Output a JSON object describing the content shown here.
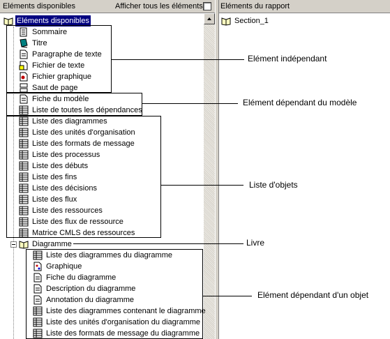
{
  "left_header": {
    "title": "Eléments disponibles",
    "show_all_label": "Afficher tous les éléments"
  },
  "right_header": {
    "title": "Eléments du rapport"
  },
  "report_tree": {
    "section": "Section_1"
  },
  "tree": {
    "root": "Eléments disponibles",
    "independent": [
      "Sommaire",
      "Titre",
      "Paragraphe de texte",
      "Fichier de texte",
      "Fichier graphique",
      "Saut de page"
    ],
    "model_dependent": [
      "Fiche du modèle",
      "Liste de toutes les dépendances"
    ],
    "object_lists": [
      "Liste des diagrammes",
      "Liste des unités d'organisation",
      "Liste des formats de message",
      "Liste des processus",
      "Liste des débuts",
      "Liste des fins",
      "Liste des décisions",
      "Liste des flux",
      "Liste des ressources",
      "Liste des flux de ressource",
      "Matrice CMLS des ressources"
    ],
    "book": "Diagramme",
    "object_dependent": [
      "Liste des diagrammes du diagramme",
      "Graphique",
      "Fiche du diagramme",
      "Description du diagramme",
      "Annotation du diagramme",
      "Liste des diagrammes contenant le diagramme",
      "Liste des unités d'organisation du diagramme",
      "Liste des formats de message du diagramme"
    ]
  },
  "callouts": {
    "independent": "Elément indépendant",
    "model_dependent": "Elément dépendant du modèle",
    "object_list": "Liste d'objets",
    "book": "Livre",
    "object_dependent": "Elément dépendant d'un objet"
  },
  "icons": {
    "root": "book-icon",
    "summary": "summary-icon",
    "title": "title-book-icon",
    "paragraph": "document-icon",
    "text_file": "text-file-icon",
    "graphic_file": "image-file-icon",
    "page_break": "page-break-icon",
    "list": "grid-list-icon",
    "book": "book-icon"
  }
}
